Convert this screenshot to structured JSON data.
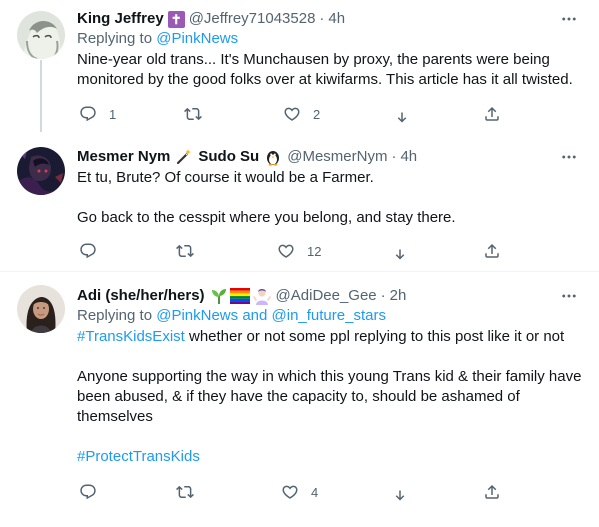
{
  "tweets": [
    {
      "name": "King Jeffrey",
      "name_emoji": "✝",
      "handle": "@Jeffrey71043528",
      "dot": "·",
      "time": "4h",
      "replying_prefix": "Replying to",
      "replying_to": "@PinkNews",
      "text": "Nine-year old trans...  It's Munchausen by proxy, the parents were being monitored by the good folks over at kiwifarms. This article has it all twisted.",
      "replies": "1",
      "retweets": "",
      "likes": "2"
    },
    {
      "name": "Mesmer Nym",
      "name_emoji": "🪄",
      "name_suffix": "Sudo Su",
      "name_emoji2": "🐧",
      "handle": "@MesmerNym",
      "dot": "·",
      "time": "4h",
      "text_lines": [
        "Et tu, Brute? Of course it would be a Farmer.",
        "Go back to the cesspit where you belong, and stay there."
      ],
      "replies": "",
      "retweets": "",
      "likes": "12"
    },
    {
      "name": "Adi (she/her/hers)",
      "name_emojis": "🌱🏳️‍🌈🤷🏻‍♀️",
      "handle": "@AdiDee_Gee",
      "dot": "·",
      "time": "2h",
      "replying_prefix": "Replying to",
      "replying_to": "@PinkNews",
      "replying_and": "and",
      "replying_to2": "@in_future_stars",
      "hashtag1": "#TransKidsExist",
      "text1": "whether or not some ppl replying to this post like it or not",
      "text2": "Anyone supporting the way in which this young Trans kid & their family have been abused, & if they have the capacity to, should be ashamed of themselves",
      "hashtag2": "#ProtectTransKids",
      "replies": "",
      "retweets": "",
      "likes": "4"
    }
  ],
  "colors": {
    "link": "#1d9bf0",
    "secondary": "#536471",
    "text": "#0f1419",
    "divider": "#eff3f4"
  },
  "icons": [
    "more-icon",
    "reply-icon",
    "retweet-icon",
    "like-icon",
    "dm-icon",
    "share-icon"
  ]
}
